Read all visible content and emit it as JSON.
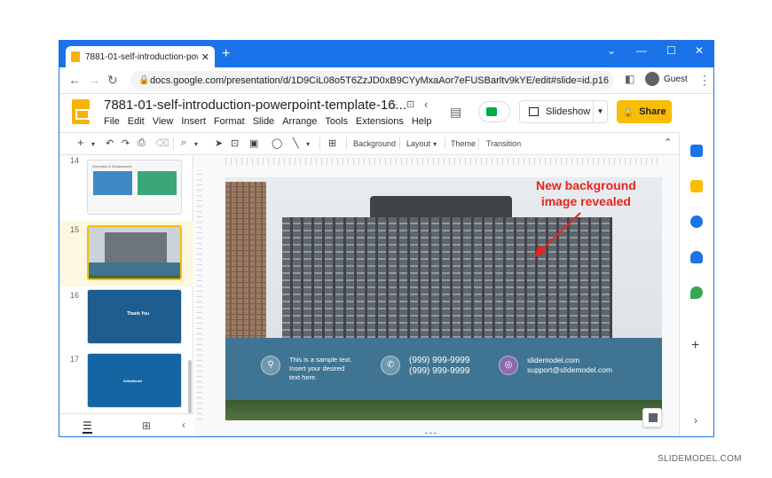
{
  "browser": {
    "tab_title": "7881-01-self-introduction-powe",
    "tab_close": "✕",
    "new_tab": "+",
    "url": "docs.google.com/presentation/d/1D9CiL08o5T6ZzJD0xB9CYyMxaAor7eFUSBarltv9kYE/edit#slide=id.p16",
    "profile_label": "Guest",
    "controls": {
      "chevron": "⌄",
      "minimize": "—",
      "maximize": "☐",
      "close": "✕"
    }
  },
  "header": {
    "doc_title": "7881-01-self-introduction-powerpoint-template-16...",
    "menu": [
      "File",
      "Edit",
      "View",
      "Insert",
      "Format",
      "Slide",
      "Arrange",
      "Tools",
      "Extensions",
      "Help"
    ],
    "slideshow_label": "Slideshow",
    "share_label": "Share"
  },
  "toolbar": {
    "background_label": "Background",
    "layout_label": "Layout",
    "theme_label": "Theme",
    "transition_label": "Transition"
  },
  "filmstrip": {
    "slides": [
      {
        "number": "14",
        "title": "Strengths & Weaknesses",
        "selected": false
      },
      {
        "number": "15",
        "selected": true
      },
      {
        "number": "16",
        "text": "Thank You",
        "selected": false
      },
      {
        "number": "17",
        "text": "SlideModel",
        "selected": false
      }
    ]
  },
  "slide": {
    "annotation": "New background image revealed",
    "annotation_line1": "New background",
    "annotation_line2": "image revealed",
    "annotation_color": "#e8231f",
    "band_color": "#3f7593",
    "contact": {
      "address_line1": "This is a sample text.",
      "address_line2": "Insert your desired",
      "address_line3": "text here.",
      "phone1": "(999) 999-9999",
      "phone2": "(999) 999-9999",
      "website": "slidemodel.com",
      "email": "support@slidemodel.com"
    }
  },
  "credit": "SLIDEMODEL.COM"
}
